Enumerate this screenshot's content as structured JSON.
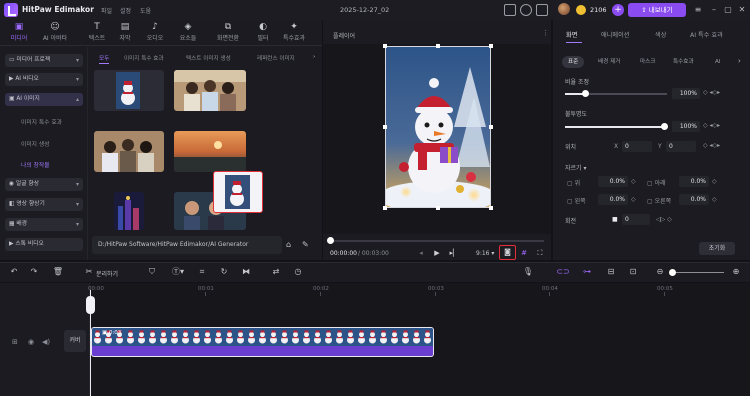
{
  "app": {
    "name": "HitPaw Edimakor",
    "menus": [
      "파일",
      "설정",
      "도움"
    ],
    "project_name": "2025-12-27_02",
    "coins": "2106",
    "export_label": "내보내기"
  },
  "tool_tabs": [
    {
      "label": "미디어",
      "icon": "media-icon"
    },
    {
      "label": "AI 아바타",
      "icon": "avatar-icon"
    },
    {
      "label": "텍스트",
      "icon": "text-icon"
    },
    {
      "label": "자막",
      "icon": "subtitle-icon"
    },
    {
      "label": "오디오",
      "icon": "audio-icon"
    },
    {
      "label": "요소들",
      "icon": "elements-icon"
    },
    {
      "label": "화면전환",
      "icon": "transition-icon"
    },
    {
      "label": "필터",
      "icon": "filter-icon"
    },
    {
      "label": "특수효과",
      "icon": "effects-icon"
    }
  ],
  "sidebar": {
    "items": [
      {
        "label": "미디어 프로젝"
      },
      {
        "label": "AI 비디오"
      },
      {
        "label": "AI 이미지"
      },
      {
        "label": "얼굴 향상"
      },
      {
        "label": "영상 향상기"
      },
      {
        "label": "배경"
      },
      {
        "label": "스톡 비디오"
      }
    ],
    "subitems": [
      "이미지 특수 효과",
      "이미지 생성",
      "나의 창작물"
    ]
  },
  "sub_tabs": [
    "모두",
    "이미지 특수 효과",
    "텍스트 이미지 생성",
    "레퍼런스 이미지"
  ],
  "path": "D:/HitPaw Software/HitPaw Edimakor/AI Generator",
  "player": {
    "title": "플레이어",
    "time_current": "00:00:00",
    "time_total": "/ 00:03:00",
    "ratio": "9:16"
  },
  "right_panel": {
    "tabs": [
      "화면",
      "애니메이션",
      "색상",
      "AI 특수 효과"
    ],
    "sub_tabs": [
      "표준",
      "배경 제거",
      "마스크",
      "특수효과",
      "AI"
    ],
    "scale_label": "비율 조정",
    "scale_value": "100%",
    "opacity_label": "불투명도",
    "opacity_value": "100%",
    "position_label": "위치",
    "pos_x_label": "X",
    "pos_x": "0",
    "pos_y_label": "Y",
    "pos_y": "0",
    "crop_label": "자르기",
    "crop_fields": [
      {
        "label": "위",
        "value": "0.0%"
      },
      {
        "label": "아래",
        "value": "0.0%"
      },
      {
        "label": "왼쪽",
        "value": "0.0%"
      },
      {
        "label": "오른쪽",
        "value": "0.0%"
      }
    ],
    "rotate_label": "회전",
    "rotate_value": "0",
    "reset_label": "초기화"
  },
  "timeline": {
    "split_label": "분리하기",
    "ruler": [
      "00:00",
      "00:01",
      "00:02",
      "00:03",
      "00:04",
      "00:05"
    ],
    "clip_label": "0:03",
    "cover_label": "커버"
  },
  "colors": {
    "accent": "#8a4cf0",
    "highlight": "#e0303a",
    "panel": "#1b1b21"
  }
}
